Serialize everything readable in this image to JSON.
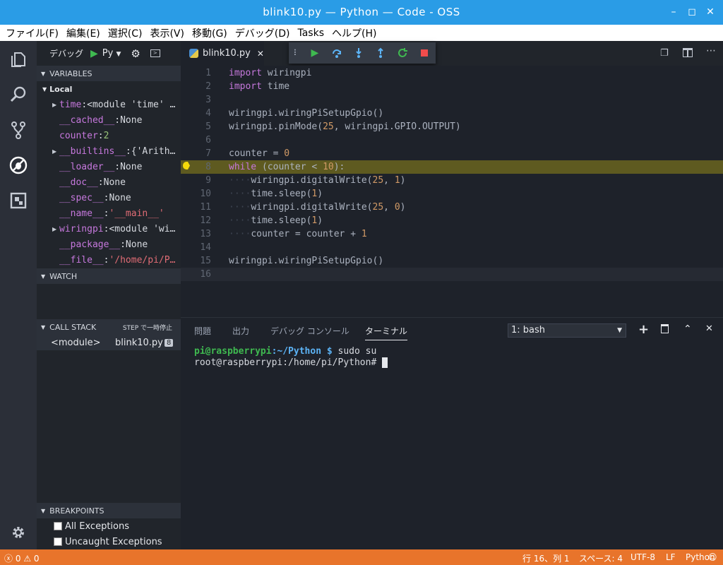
{
  "window": {
    "title": "blink10.py — Python — Code - OSS"
  },
  "menu": [
    "ファイル(F)",
    "編集(E)",
    "選択(C)",
    "表示(V)",
    "移動(G)",
    "デバッグ(D)",
    "Tasks",
    "ヘルプ(H)"
  ],
  "sidebar": {
    "debug_label": "デバッグ",
    "config": "Py",
    "variables_header": "VARIABLES",
    "local_label": "Local",
    "variables": [
      {
        "name": "time",
        "sep": ": ",
        "value": "<module 'time' …",
        "expandable": true,
        "kind": "val"
      },
      {
        "name": "__cached__",
        "sep": ": ",
        "value": "None",
        "expandable": false,
        "kind": "val"
      },
      {
        "name": "counter",
        "sep": ": ",
        "value": "2",
        "expandable": false,
        "kind": "num"
      },
      {
        "name": "__builtins__",
        "sep": ": ",
        "value": "{'Arith…",
        "expandable": true,
        "kind": "val"
      },
      {
        "name": "__loader__",
        "sep": ": ",
        "value": "None",
        "expandable": false,
        "kind": "val"
      },
      {
        "name": "__doc__",
        "sep": ": ",
        "value": "None",
        "expandable": false,
        "kind": "val"
      },
      {
        "name": "__spec__",
        "sep": ": ",
        "value": "None",
        "expandable": false,
        "kind": "val"
      },
      {
        "name": "__name__",
        "sep": ": ",
        "value": "'__main__'",
        "expandable": false,
        "kind": "str"
      },
      {
        "name": "wiringpi",
        "sep": ": ",
        "value": "<module 'wi…",
        "expandable": true,
        "kind": "val"
      },
      {
        "name": "__package__",
        "sep": ": ",
        "value": "None",
        "expandable": false,
        "kind": "val"
      },
      {
        "name": "__file__",
        "sep": ": ",
        "value": "'/home/pi/P…",
        "expandable": false,
        "kind": "str"
      }
    ],
    "watch_header": "WATCH",
    "callstack_header": "CALL STACK",
    "callstack_status": "STEP で一時停止",
    "callstack_frame": "<module>",
    "callstack_file": "blink10.py",
    "callstack_line": "8",
    "breakpoints_header": "BREAKPOINTS",
    "breakpoints": [
      "All Exceptions",
      "Uncaught Exceptions"
    ]
  },
  "editor": {
    "tab_label": "blink10.py",
    "current_line": 8,
    "lines": [
      "1",
      "2",
      "3",
      "4",
      "5",
      "6",
      "7",
      "8",
      "9",
      "10",
      "11",
      "12",
      "13",
      "14",
      "15",
      "16"
    ]
  },
  "panel": {
    "tabs": [
      "問題",
      "出力",
      "デバッグ コンソール",
      "ターミナル"
    ],
    "terminal_select": "1: bash",
    "term_user": "pi@raspberrypi",
    "term_path": ":~/Python $",
    "term_cmd": " sudo su",
    "term_line2": "root@raspberrypi:/home/pi/Python# "
  },
  "statusbar": {
    "errors": "0",
    "warnings": "0",
    "position": "行 16、列 1",
    "spaces": "スペース: 4",
    "encoding": "UTF-8",
    "eol": "LF",
    "language": "Python"
  },
  "colors": {
    "titlebar": "#2a9ce6",
    "statusbar": "#e8742b",
    "highlight": "#5e5a20"
  }
}
